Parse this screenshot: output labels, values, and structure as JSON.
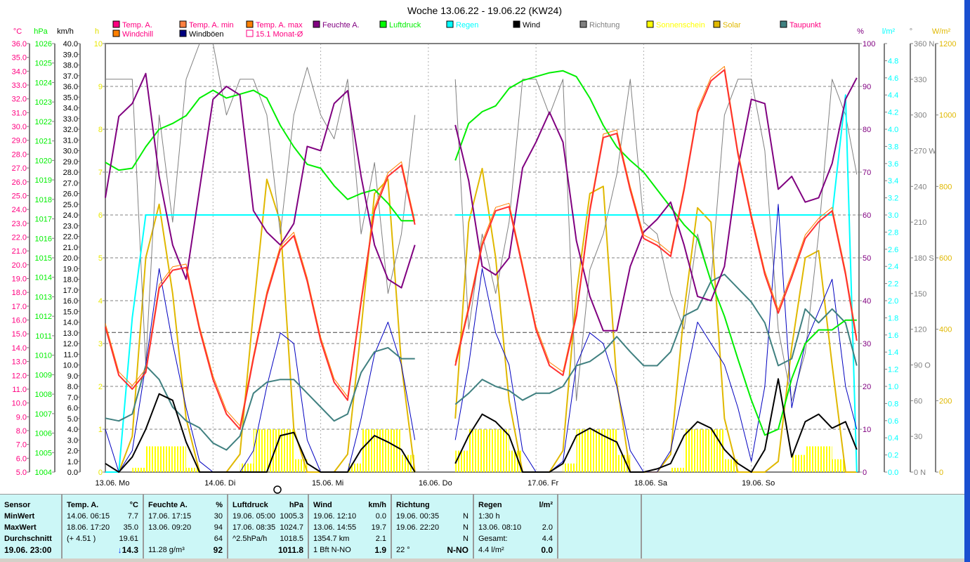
{
  "title": "Woche 13.06.22 - 19.06.22 (KW24)",
  "chart_data": {
    "type": "line",
    "title": "Woche 13.06.22 - 19.06.22 (KW24)",
    "x_step_hours": 3,
    "x_range_hours": [
      0,
      168
    ],
    "xaxis_labels": [
      "13.06. Mo",
      "14.06. Di",
      "15.06. Mi",
      "16.06. Do",
      "17.06. Fr",
      "18.06. Sa",
      "19.06. So"
    ],
    "axes": {
      "temp": {
        "unit": "°C",
        "min": 5,
        "max": 36,
        "step": 1,
        "dec": 1,
        "color": "#ff0080",
        "side": "left"
      },
      "press": {
        "unit": "hPa",
        "min": 1004,
        "max": 1026,
        "step": 1,
        "dec": 0,
        "color": "#00ee00",
        "side": "left"
      },
      "wind": {
        "unit": "km/h",
        "min": 0,
        "max": 40,
        "step": 1,
        "dec": 1,
        "color": "#000000",
        "side": "left"
      },
      "sun": {
        "unit": "h",
        "min": 0,
        "max": 10,
        "step": 1,
        "dec": 0,
        "color": "#ffff00",
        "side": "left"
      },
      "hum": {
        "unit": "%",
        "min": 0,
        "max": 100,
        "step": 10,
        "dec": 0,
        "color": "#800080",
        "side": "right"
      },
      "rain": {
        "unit": "l/m²",
        "min": 0,
        "max": 5,
        "step": 0.2,
        "dec": 1,
        "labelmax": 4.8,
        "color": "#00ffff",
        "side": "right"
      },
      "dir": {
        "unit": "°",
        "min": 0,
        "max": 360,
        "step": 30,
        "dec": 0,
        "color": "#808080",
        "side": "right",
        "compass": {
          "0": "N",
          "90": "O",
          "180": "S",
          "270": "W",
          "360": "N"
        }
      },
      "solar": {
        "unit": "W/m²",
        "min": 0,
        "max": 1200,
        "step": 200,
        "dec": 0,
        "color": "#e0b800",
        "side": "right"
      }
    },
    "legend": [
      {
        "label": "Temp. A.",
        "color": "#ff0080",
        "text": "#ff0080"
      },
      {
        "label": "Temp. A. min",
        "color": "#ff8040",
        "text": "#ff0080"
      },
      {
        "label": "Temp. A. max",
        "color": "#ff8000",
        "text": "#ff0080"
      },
      {
        "label": "Feuchte A.",
        "color": "#800080",
        "text": "#800080"
      },
      {
        "label": "Luftdruck",
        "color": "#00ff00",
        "text": "#00ee00"
      },
      {
        "label": "Regen",
        "color": "#00ffff",
        "text": "#00ffff"
      },
      {
        "label": "Wind",
        "color": "#000000",
        "text": "#000000"
      },
      {
        "label": "Richtung",
        "color": "#808080",
        "text": "#808080"
      },
      {
        "label": "Sonnenschein",
        "color": "#ffff00",
        "text": "#ffff00"
      },
      {
        "label": "Solar",
        "color": "#e0b800",
        "text": "#e0b800"
      },
      {
        "label": "Taupunkt",
        "color": "#408080",
        "text": "#ff0080"
      },
      {
        "label": "Windchill",
        "color": "#ff8000",
        "text": "#ff0080"
      },
      {
        "label": "Windböen",
        "color": "#000080",
        "text": "#000000"
      },
      {
        "label": "15.1 Monat-Ø",
        "color": "none",
        "text": "#ff0080"
      }
    ],
    "month_avg_temp": 15.1,
    "series": [
      {
        "name": "Solar",
        "axis": "solar",
        "color": "#e0b800",
        "width": 2,
        "values": [
          0,
          0,
          100,
          600,
          750,
          500,
          150,
          0,
          0,
          0,
          50,
          450,
          820,
          700,
          120,
          0,
          0,
          0,
          50,
          400,
          780,
          820,
          300,
          0,
          null,
          null,
          150,
          700,
          850,
          600,
          200,
          0,
          0,
          0,
          60,
          500,
          780,
          800,
          250,
          0,
          0,
          0,
          50,
          450,
          740,
          700,
          150,
          0,
          0,
          0,
          30,
          350,
          600,
          620,
          300,
          0,
          0
        ]
      },
      {
        "name": "Richtung",
        "axis": "dir",
        "color": "#808080",
        "width": 1,
        "values": [
          330,
          330,
          330,
          90,
          300,
          210,
          330,
          360,
          360,
          300,
          330,
          330,
          300,
          200,
          300,
          340,
          300,
          280,
          330,
          200,
          260,
          150,
          200,
          300,
          null,
          null,
          330,
          120,
          200,
          150,
          210,
          330,
          330,
          300,
          330,
          60,
          170,
          200,
          250,
          330,
          210,
          200,
          150,
          120,
          200,
          160,
          300,
          330,
          330,
          270,
          120,
          60,
          100,
          200,
          330,
          300,
          250
        ]
      },
      {
        "name": "Regen",
        "axis": "rain",
        "color": "#00ffff",
        "width": 2,
        "values": [
          0,
          0,
          1.8,
          3.0,
          3.0,
          3.0,
          3.0,
          3.0,
          3.0,
          3.0,
          3.0,
          3.0,
          3.0,
          3.0,
          3.0,
          3.0,
          3.0,
          3.0,
          3.0,
          3.0,
          3.0,
          3.0,
          3.0,
          3.0,
          null,
          null,
          3.0,
          3.0,
          3.0,
          3.0,
          3.0,
          3.0,
          3.0,
          3.0,
          3.0,
          3.0,
          3.0,
          3.0,
          3.0,
          3.0,
          3.0,
          3.0,
          3.0,
          3.0,
          3.0,
          3.0,
          3.0,
          3.0,
          3.0,
          3.0,
          3.0,
          3.0,
          3.0,
          3.0,
          3.0,
          4.4,
          0
        ]
      },
      {
        "name": "Windböen",
        "axis": "wind",
        "color": "#0000c0",
        "width": 1,
        "values": [
          4,
          0,
          2,
          10,
          19,
          12,
          6,
          1,
          0,
          0,
          0,
          2,
          8,
          13,
          12,
          3,
          0,
          0,
          0,
          5,
          11,
          14,
          10,
          3,
          null,
          null,
          3,
          10,
          19,
          13,
          10,
          2,
          0,
          0,
          1,
          10,
          13,
          12,
          8,
          2,
          0,
          0,
          2,
          8,
          14,
          12,
          10,
          6,
          1,
          8,
          25,
          6,
          12,
          15,
          18,
          8,
          4
        ]
      },
      {
        "name": "Taupunkt",
        "axis": "temp",
        "color": "#408080",
        "width": 2,
        "values": [
          8.9,
          8.7,
          9.2,
          12.7,
          11.7,
          9.7,
          8.7,
          8.2,
          7.1,
          6.6,
          7.6,
          10.7,
          11.5,
          11.7,
          11.7,
          10.7,
          9.7,
          8.7,
          9.2,
          12.2,
          13.7,
          14,
          13.2,
          13.2,
          null,
          null,
          9.9,
          10.7,
          11.7,
          11.2,
          10.9,
          10.2,
          10.7,
          10.7,
          11.2,
          12.7,
          13,
          13.7,
          14.8,
          13.7,
          12.7,
          12.7,
          13.7,
          16.3,
          16.8,
          18.8,
          19.3,
          18.3,
          17.3,
          15.8,
          12.7,
          13.2,
          16.8,
          15.8,
          16.8,
          15.8,
          12.7
        ]
      },
      {
        "name": "Luftdruck",
        "axis": "press",
        "color": "#00ee00",
        "width": 2,
        "values": [
          1019.9,
          1019.5,
          1019.6,
          1020.7,
          1021.6,
          1021.9,
          1022.3,
          1023.2,
          1023.6,
          1023.2,
          1023.4,
          1023.6,
          1023.2,
          1021.8,
          1020.7,
          1019.8,
          1019.6,
          1018.7,
          1018,
          1018.3,
          1018.5,
          1017.8,
          1016.9,
          1016.9,
          null,
          null,
          1020,
          1021.9,
          1022.5,
          1022.8,
          1023.7,
          1024.1,
          1024.3,
          1024.5,
          1024.6,
          1024.3,
          1023.2,
          1021.8,
          1020.7,
          1020,
          1019.4,
          1018.5,
          1017.6,
          1016.7,
          1016,
          1013.8,
          1012,
          1009.8,
          1007.7,
          1005.9,
          1006.2,
          1008.8,
          1010.6,
          1011.3,
          1011.3,
          1011.8,
          1011.8
        ]
      },
      {
        "name": "Feuchte A.",
        "axis": "hum",
        "color": "#800080",
        "width": 2,
        "values": [
          64,
          83,
          86,
          93,
          69,
          53,
          45,
          66,
          87,
          90,
          88,
          61,
          56,
          53,
          58,
          76,
          75,
          86,
          89,
          69,
          53,
          45,
          43,
          53,
          null,
          null,
          81,
          68,
          48,
          46,
          50,
          71,
          77,
          84,
          77,
          54,
          41,
          33,
          33,
          48,
          56,
          59,
          63,
          53,
          41,
          40,
          48,
          71,
          87,
          86,
          66,
          69,
          63,
          64,
          72,
          87,
          92
        ]
      },
      {
        "name": "Wind",
        "axis": "wind",
        "color": "#000000",
        "width": 2,
        "values": [
          0.8,
          0,
          1.4,
          4,
          7.3,
          6.7,
          2.8,
          0,
          0,
          0,
          0,
          0,
          0,
          3.4,
          3.7,
          0.8,
          0,
          0,
          0,
          2.1,
          3.4,
          2.8,
          2.1,
          0,
          null,
          null,
          0.8,
          3.4,
          5.4,
          4.7,
          3.4,
          0,
          0,
          0,
          0.8,
          3.4,
          4.1,
          3.4,
          2.8,
          0,
          0,
          0.3,
          0.8,
          3.4,
          4.7,
          4.1,
          2.1,
          0.8,
          0,
          2.1,
          8.7,
          1.4,
          4.7,
          5.4,
          4.1,
          4.7,
          2.1
        ]
      },
      {
        "name": "Temp. A. max",
        "axis": "temp",
        "color": "#ff8000",
        "width": 1,
        "offset": 0.25,
        "values": [
          15.5,
          12,
          11,
          12.2,
          18.3,
          19.6,
          19.8,
          15.3,
          11.7,
          9.2,
          8.1,
          13.2,
          17.8,
          21.1,
          22.1,
          18.8,
          14.5,
          11.5,
          10.2,
          17.3,
          23.9,
          26.4,
          27.2,
          22.9,
          null,
          null,
          12.7,
          16.8,
          21.4,
          23.9,
          24.2,
          19.8,
          15.3,
          12.7,
          12,
          16.3,
          23.9,
          29.2,
          29.5,
          25.4,
          21.9,
          21.4,
          20.6,
          25.4,
          31,
          33.3,
          34.1,
          28,
          23.4,
          19.3,
          16.5,
          19.1,
          21.9,
          23.1,
          23.9,
          19.3,
          14.5
        ]
      },
      {
        "name": "Temp. A.",
        "axis": "temp",
        "color": "#ff3030",
        "width": 2,
        "values": [
          15.5,
          12,
          11,
          12.2,
          18.3,
          19.6,
          19.8,
          15.3,
          11.7,
          9.2,
          8.1,
          13.2,
          17.8,
          21.1,
          22.1,
          18.8,
          14.5,
          11.5,
          10.2,
          17.3,
          23.9,
          26.4,
          27.2,
          22.9,
          null,
          null,
          12.7,
          16.8,
          21.4,
          23.9,
          24.2,
          19.8,
          15.3,
          12.7,
          12,
          16.3,
          23.9,
          29.2,
          29.5,
          25.4,
          21.9,
          21.4,
          20.6,
          25.4,
          31,
          33.3,
          34.1,
          28,
          23.4,
          19.3,
          16.5,
          19.1,
          21.9,
          23.1,
          23.9,
          19.3,
          14.5
        ]
      }
    ],
    "sunshine": {
      "name": "Sonnenschein",
      "axis": "sun",
      "color": "#ffff00",
      "values": [
        0,
        0,
        0.1,
        0.6,
        0.6,
        0.6,
        0.1,
        0,
        0,
        0,
        0.2,
        1,
        1,
        1,
        0.3,
        0,
        0,
        0,
        0.2,
        1,
        1,
        1,
        0.4,
        0,
        null,
        null,
        0.5,
        1,
        1,
        1,
        0.5,
        0,
        0,
        0,
        0.2,
        1,
        1,
        1,
        0.4,
        0,
        0,
        0,
        0.1,
        1,
        1,
        1,
        0.3,
        0,
        0,
        0,
        0,
        0.4,
        0.6,
        0.6,
        0.3,
        0,
        0
      ]
    }
  },
  "table": {
    "sensor": {
      "header": "Sensor",
      "rows": [
        "MinWert",
        "MaxWert",
        "Durchschnitt",
        "19.06. 23:00"
      ]
    },
    "columns": [
      {
        "header": "Temp. A.",
        "unit": "°C",
        "rows": [
          [
            "14.06.  06:15",
            "7.7"
          ],
          [
            "18.06.  17:20",
            "35.0"
          ],
          [
            "(+ 4.51 )",
            "19.61"
          ],
          [
            "",
            "14.3"
          ]
        ],
        "trend_icon": "↓"
      },
      {
        "header": "Feuchte A.",
        "unit": "%",
        "rows": [
          [
            "17.06.  17:15",
            "30"
          ],
          [
            "13.06.  09:20",
            "94"
          ],
          [
            "",
            "64"
          ],
          [
            "11.28 g/m³",
            "92"
          ]
        ]
      },
      {
        "header": "Luftdruck",
        "unit": "hPa",
        "rows": [
          [
            "19.06.  05:00",
            "1005.3"
          ],
          [
            "17.06.  08:35",
            "1024.7"
          ],
          [
            "^2.5hPa/h",
            "1018.5"
          ],
          [
            "",
            "1011.8"
          ]
        ]
      },
      {
        "header": "Wind",
        "unit": "km/h",
        "rows": [
          [
            "19.06.  12:10",
            "0.0"
          ],
          [
            "13.06.  14:55",
            "19.7"
          ],
          [
            "1354.7 km",
            "2.1"
          ],
          [
            "1 Bft N-NO",
            "1.9"
          ]
        ]
      },
      {
        "header": "Richtung",
        "unit": "",
        "rows": [
          [
            "19.06.  00:35",
            "N"
          ],
          [
            "19.06.  22:20",
            "N"
          ],
          [
            "",
            "N"
          ],
          [
            "22 °",
            "N-NO"
          ]
        ]
      },
      {
        "header": "Regen",
        "unit": "l/m²",
        "rows": [
          [
            "1:30 h",
            ""
          ],
          [
            "13.06.  08:10",
            "2.0"
          ],
          [
            "Gesamt:",
            "4.4"
          ],
          [
            "4.4 l/m²",
            "0.0"
          ]
        ]
      }
    ]
  }
}
